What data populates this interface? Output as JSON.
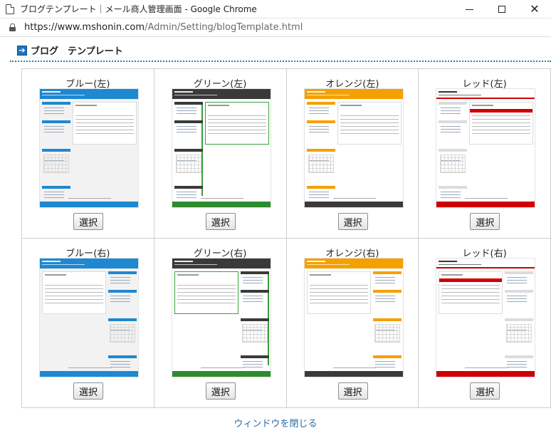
{
  "window": {
    "title": "ブログテンプレート｜メール商人管理画面 - Google Chrome"
  },
  "address": {
    "url_host": "https://www.mshonin.com",
    "url_path": "/Admin/Setting/blogTemplate.html"
  },
  "page": {
    "heading": "ブログ　テンプレート",
    "heading_icon": "arrow-right-icon",
    "close_link": "ウィンドウを閉じる",
    "select_label": "選択"
  },
  "templates": [
    {
      "name": "ブルー(左)",
      "sidebar": "left",
      "color": "#1e88d0",
      "footer": "#1e88d0"
    },
    {
      "name": "グリーン(左)",
      "sidebar": "left",
      "color": "#3a3a3a",
      "footer": "#2e8b2e",
      "accent": "#3aa03a"
    },
    {
      "name": "オレンジ(左)",
      "sidebar": "left",
      "color": "#f5a000",
      "footer": "#3a3a3a"
    },
    {
      "name": "レッド(左)",
      "sidebar": "left",
      "color": "#ffffff",
      "footer": "#d10000",
      "accent": "#d10000"
    },
    {
      "name": "ブルー(右)",
      "sidebar": "right",
      "color": "#1e88d0",
      "footer": "#1e88d0"
    },
    {
      "name": "グリーン(右)",
      "sidebar": "right",
      "color": "#3a3a3a",
      "footer": "#2e8b2e",
      "accent": "#3aa03a"
    },
    {
      "name": "オレンジ(右)",
      "sidebar": "right",
      "color": "#f5a000",
      "footer": "#3a3a3a"
    },
    {
      "name": "レッド(右)",
      "sidebar": "right",
      "color": "#ffffff",
      "footer": "#d10000",
      "accent": "#d10000"
    }
  ]
}
